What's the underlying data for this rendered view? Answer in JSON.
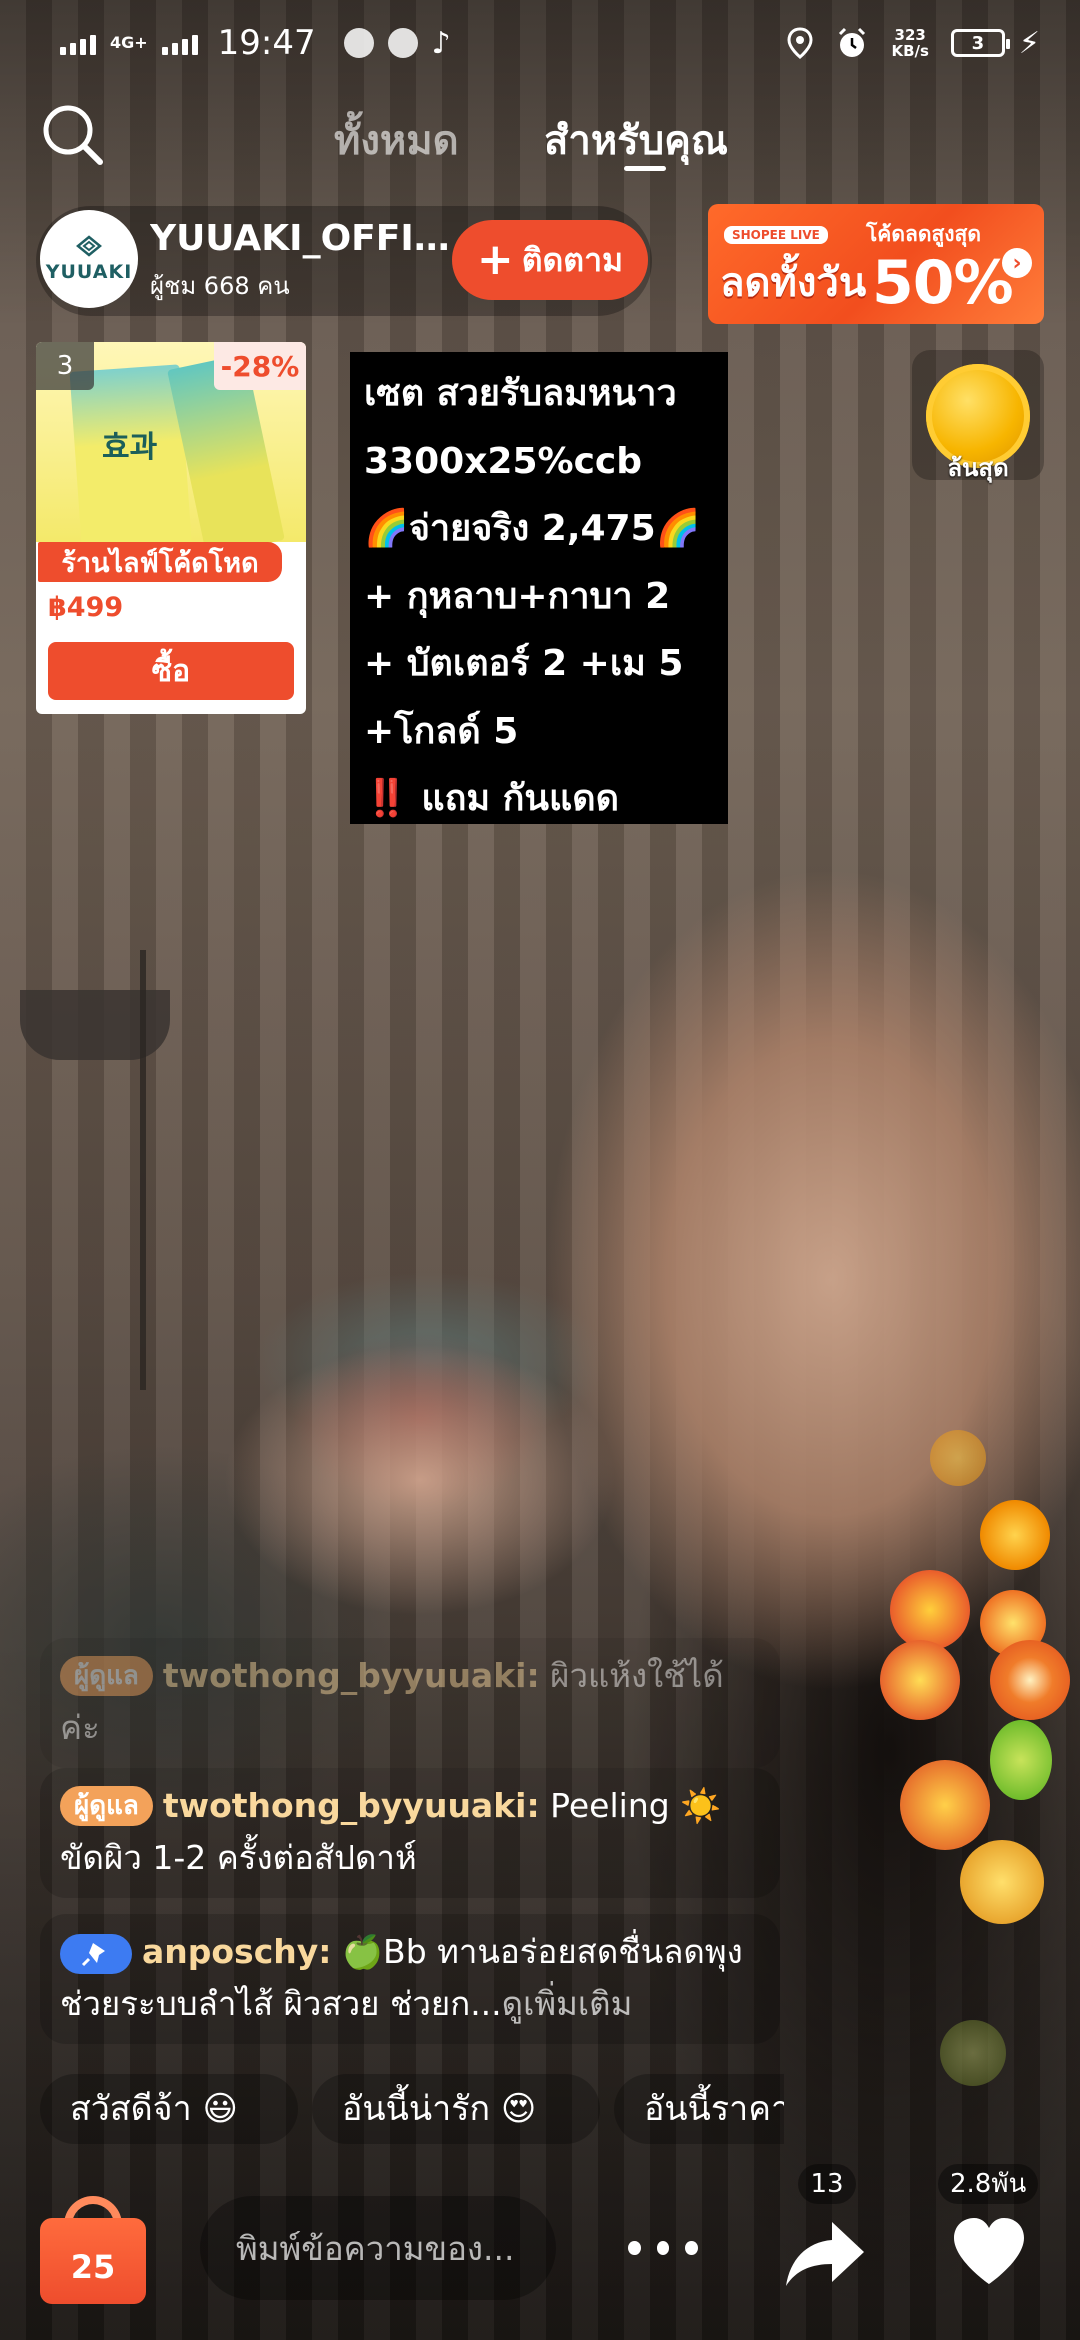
{
  "status_bar": {
    "network": "4G+",
    "time": "19:47",
    "speed_value": "323",
    "speed_unit": "KB/s",
    "battery": "3"
  },
  "nav": {
    "tabs": [
      {
        "label": "ทั้งหมด",
        "active": false
      },
      {
        "label": "สำหรับคุณ",
        "active": true
      }
    ]
  },
  "host": {
    "avatar_text": "YUUAKI",
    "name": "YUUAKI_OFFIC...",
    "viewers": "ผู้ชม 668 คน",
    "follow_label": "ติดตาม"
  },
  "promo": {
    "badge": "SHOPEE LIVE",
    "main_text": "ลดทั้งวัน",
    "top_text": "โค้ดลดสูงสุด",
    "percent": "50%",
    "brand_color": "#ee4d2d"
  },
  "coin": {
    "label": "ล้นสุด"
  },
  "product": {
    "index": "3",
    "discount": "-28%",
    "image_text": "효과",
    "tag": "ร้านไลฟ์โค้ดโหด",
    "price": "฿499",
    "buy_label": "ซื้อ"
  },
  "overlay_text": {
    "lines": [
      "เซต สวยรับลมหนาว",
      "3300x25%ccb",
      "🌈จ่ายจริง 2,475🌈",
      "+ กุหลาบ+กาบา 2",
      "+ บัตเตอร์ 2 +เม 5",
      "+โกลด์ 5",
      "แถม กันแดด"
    ],
    "alert_mark": "‼️"
  },
  "comments": [
    {
      "badge": "ผู้ดูแล",
      "user": "twothong_byyuuaki:",
      "text": "ผิวแห้งใช้ได้ค่ะ",
      "faded": true
    },
    {
      "badge": "ผู้ดูแล",
      "user": "twothong_byyuuaki:",
      "text": "Peeling ☀️ ขัดผิว 1-2 ครั้งต่อสัปดาห์",
      "faded": false
    },
    {
      "badge": "pin",
      "user": "anposchy:",
      "text": "🍏Bb ทานอร่อยสดชื่นลดพุงช่วยระบบลำไส้ ผิวสวย ช่วยก...",
      "more": "ดูเพิ่มเติม"
    }
  ],
  "quick_replies": [
    "สวัสดีจ้า 😃",
    "อันนี้น่ารัก 😍",
    "อันนี้ราคา"
  ],
  "bottom_bar": {
    "cart_count": "25",
    "input_placeholder": "พิมพ์ข้อความของ...",
    "share_count": "13",
    "like_count": "2.8พัน"
  }
}
